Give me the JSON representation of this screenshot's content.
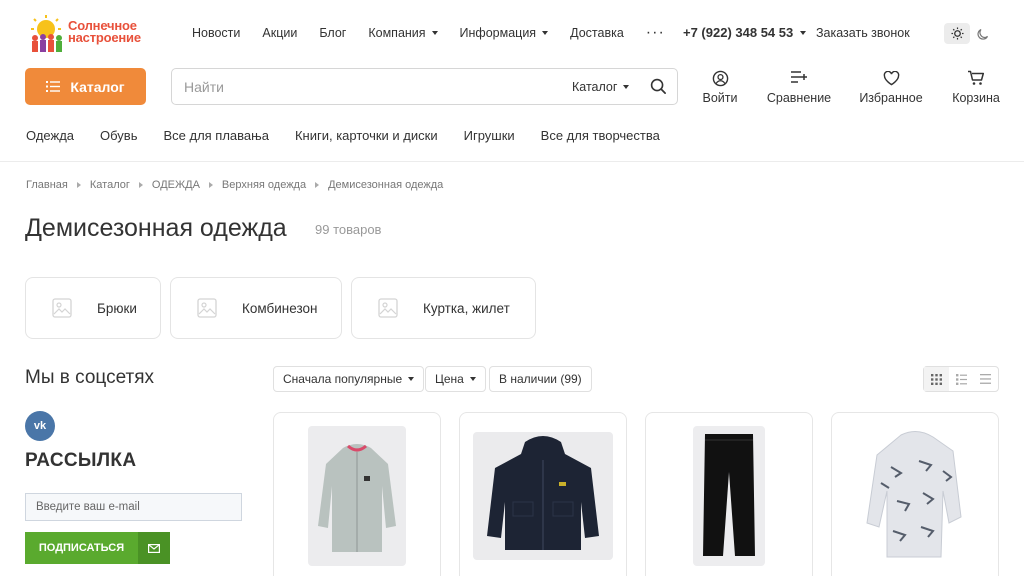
{
  "brand": {
    "line1": "Солнечное",
    "line2": "настроение"
  },
  "top_nav": [
    {
      "label": "Новости",
      "has_caret": false
    },
    {
      "label": "Акции",
      "has_caret": false
    },
    {
      "label": "Блог",
      "has_caret": false
    },
    {
      "label": "Компания",
      "has_caret": true
    },
    {
      "label": "Информация",
      "has_caret": true
    },
    {
      "label": "Доставка",
      "has_caret": false
    }
  ],
  "more_label": "···",
  "phone": "+7 (922) 348 54 53",
  "callback_label": "Заказать звонок",
  "catalog_button": "Каталог",
  "search": {
    "placeholder": "Найти",
    "scope": "Каталог"
  },
  "header_actions": [
    {
      "label": "Войти",
      "icon": "user-icon"
    },
    {
      "label": "Сравнение",
      "icon": "compare-icon"
    },
    {
      "label": "Избранное",
      "icon": "heart-icon"
    },
    {
      "label": "Корзина",
      "icon": "cart-icon"
    }
  ],
  "category_nav": [
    "Одежда",
    "Обувь",
    "Все для плавања",
    "Книги, карточки и диски",
    "Игрушки",
    "Все для творчества"
  ],
  "breadcrumbs": [
    "Главная",
    "Каталог",
    "ОДЕЖДА",
    "Верхняя одежда",
    "Демисезонная одежда"
  ],
  "page_title": "Демисезонная одежда",
  "product_count": "99 товаров",
  "subcategories": [
    "Брюки",
    "Комбинезон",
    "Куртка, жилет"
  ],
  "sidebar": {
    "social_title": "Мы в соцсетях",
    "vk_label": "vk",
    "newsletter_title": "РАССЫЛКА",
    "email_placeholder": "Введите ваш e-mail",
    "subscribe_label": "ПОДПИСАТЬСЯ"
  },
  "filters": {
    "sort": "Сначала популярные",
    "price": "Цена",
    "stock": "В наличии (99)"
  },
  "colors": {
    "accent_orange": "#f08a3a",
    "green": "#5aaa2e",
    "vk_blue": "#4a76a8"
  }
}
